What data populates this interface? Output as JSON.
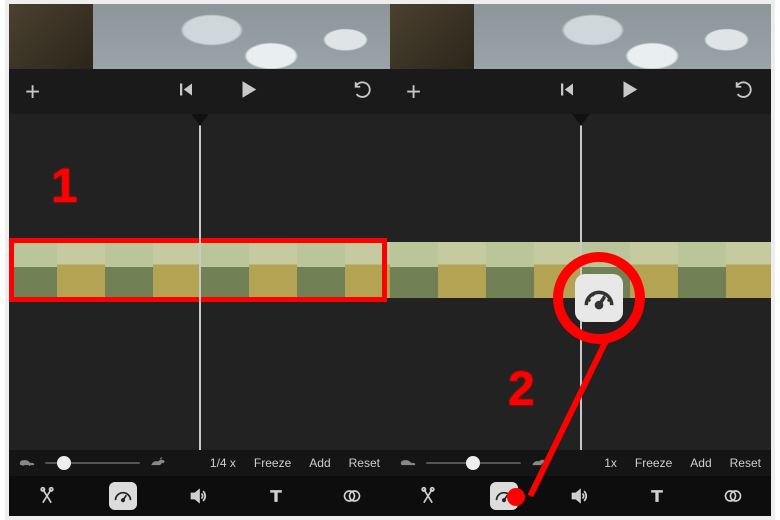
{
  "annotations": {
    "step1": "1",
    "step2": "2"
  },
  "left": {
    "speed": {
      "value_label": "1/4 x",
      "freeze": "Freeze",
      "add": "Add",
      "reset": "Reset",
      "knob_percent": 18
    },
    "tools": {
      "selected": "speed"
    }
  },
  "right": {
    "speed": {
      "value_label": "1x",
      "freeze": "Freeze",
      "add": "Add",
      "reset": "Reset",
      "knob_percent": 50
    },
    "tools": {
      "selected": "speed"
    }
  },
  "icons": {
    "add": "plus-icon",
    "prev": "skip-start-icon",
    "play": "play-icon",
    "undo": "undo-icon",
    "tortoise": "tortoise-icon",
    "hare": "hare-icon",
    "cut": "scissors-icon",
    "speed": "speedometer-icon",
    "volume": "speaker-icon",
    "text": "text-icon",
    "filter": "overlap-circles-icon"
  }
}
